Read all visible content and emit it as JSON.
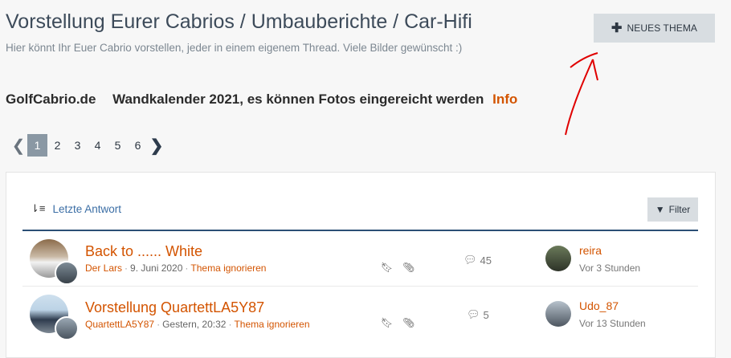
{
  "header": {
    "title": "Vorstellung Eurer Cabrios / Umbauberichte / Car-Hifi",
    "subtitle": "Hier könnt Ihr Euer Cabrio vorstellen, jeder in einem eigenem Thread. Viele Bilder gewünscht :)",
    "new_thread_label": "NEUES THEMA"
  },
  "promo": {
    "site": "GolfCabrio.de",
    "text": "Wandkalender 2021, es können Fotos eingereicht werden",
    "info_label": "Info"
  },
  "pagination": {
    "pages": [
      "1",
      "2",
      "3",
      "4",
      "5",
      "6"
    ],
    "current": "1"
  },
  "list": {
    "sort_label": "Letzte Antwort",
    "filter_label": "Filter",
    "threads": [
      {
        "title": "Back to ...... White",
        "author": "Der Lars",
        "date": "9. Juni 2020",
        "ignore": "Thema ignorieren",
        "replies": "45",
        "last_user": "reira",
        "last_time": "Vor 3 Stunden"
      },
      {
        "title": "Vorstellung QuartettLA5Y87",
        "author": "QuartettLA5Y87",
        "date": "Gestern, 20:32",
        "ignore": "Thema ignorieren",
        "replies": "5",
        "last_user": "Udo_87",
        "last_time": "Vor 13 Stunden"
      }
    ]
  },
  "colors": {
    "accent": "#d35400",
    "link": "#3b6ea5",
    "divider": "#2b4f75",
    "button_bg": "#d8dde1",
    "annotation": "#e00000"
  }
}
